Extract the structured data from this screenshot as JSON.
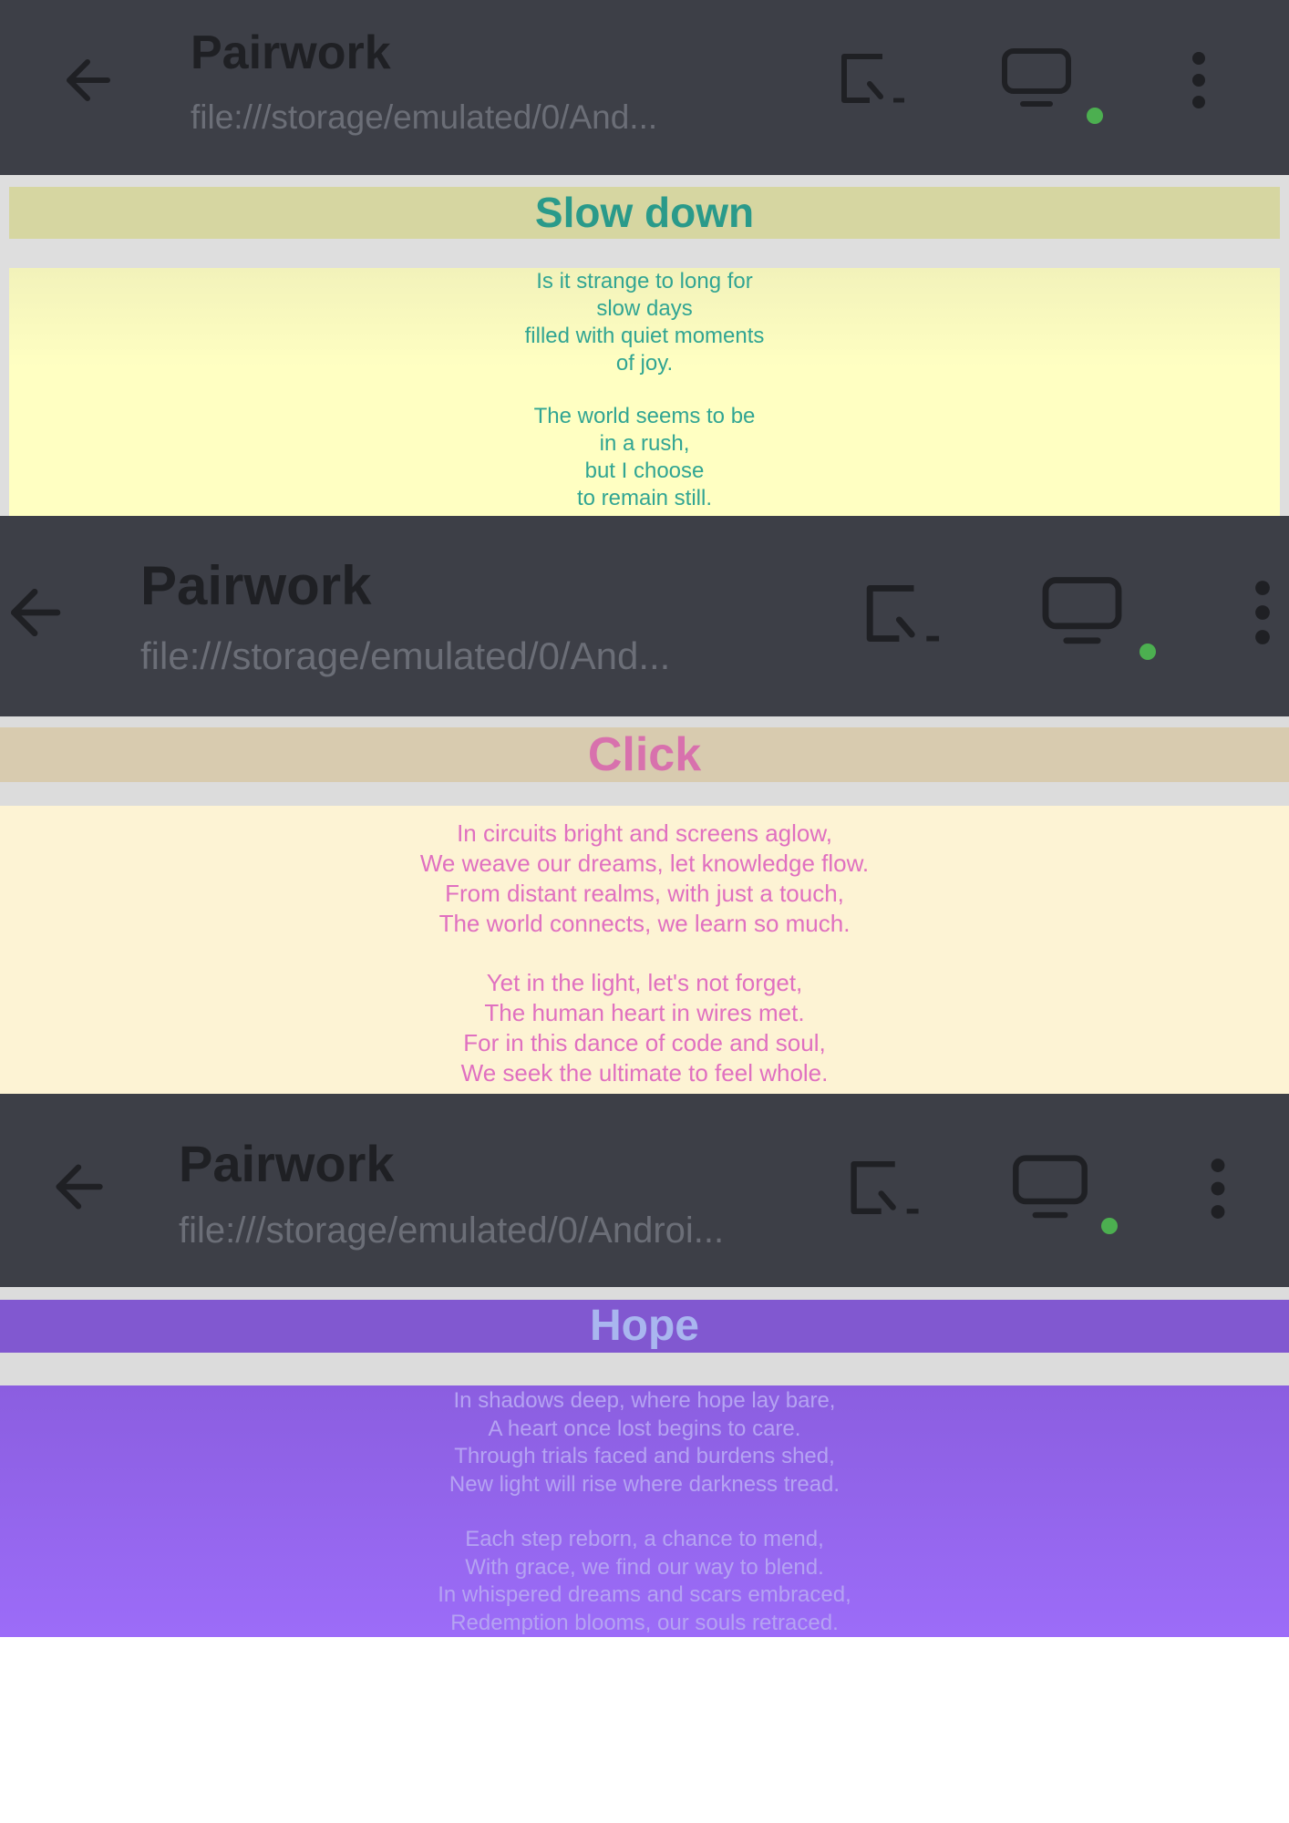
{
  "app_title": "Pairwork",
  "panels": [
    {
      "title": "Pairwork",
      "url": "file:///storage/emulated/0/And...",
      "heading": "Slow down",
      "stanzas": [
        [
          "Is it strange to long for",
          "slow days",
          "filled with quiet moments",
          "of joy."
        ],
        [
          "The world seems to be",
          "in a rush,",
          "but I choose",
          "to remain still."
        ]
      ]
    },
    {
      "title": "Pairwork",
      "url": "file:///storage/emulated/0/And...",
      "heading": "Click",
      "stanzas": [
        [
          "In circuits bright and screens aglow,",
          "We weave our dreams, let knowledge flow.",
          "From distant realms, with just a touch,",
          "The world connects, we learn so much."
        ],
        [
          "Yet in the light, let's not forget,",
          "The human heart in wires met.",
          "For in this dance of code and soul,",
          "We seek the ultimate to feel whole."
        ]
      ]
    },
    {
      "title": "Pairwork",
      "url": "file:///storage/emulated/0/Androi...",
      "heading": "Hope",
      "stanzas": [
        [
          "In shadows deep, where hope lay bare,",
          "A heart once lost begins to care.",
          "Through trials faced and burdens shed,",
          "New light will rise where darkness tread."
        ],
        [
          "Each step reborn, a chance to mend,",
          "With grace, we find our way to blend.",
          "In whispered dreams and scars embraced,",
          "Redemption blooms, our souls retraced."
        ]
      ]
    }
  ],
  "icons": {
    "back": "arrow-back-icon",
    "cast": "cast-icon",
    "screen": "monitor-icon",
    "status": "online-dot",
    "more": "more-vert-icon"
  },
  "colors": {
    "appbar": "#3d3f47",
    "status_dot": "#4caf50",
    "slow_down_heading": "#2a9a8a",
    "click_heading": "#d871ad",
    "hope_heading": "#a9b6ef"
  }
}
